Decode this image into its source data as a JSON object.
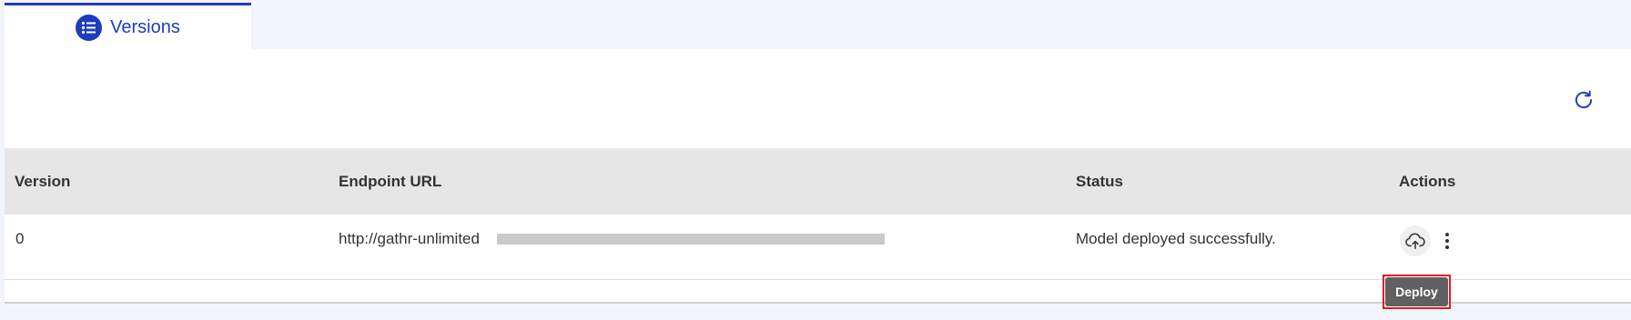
{
  "tabs": [
    {
      "label": "Versions",
      "icon": "list-icon",
      "active": true
    }
  ],
  "toolbar": {
    "refresh_icon": "refresh-icon"
  },
  "table": {
    "columns": [
      "Version",
      "Endpoint URL",
      "Status",
      "Actions"
    ],
    "rows": [
      {
        "version": "0",
        "endpoint_url": "http://gathr-unlimited",
        "status": "Model deployed successfully.",
        "actions": [
          "cloud-upload-icon",
          "more-vertical-icon"
        ]
      }
    ]
  },
  "tooltip": {
    "text": "Deploy"
  },
  "colors": {
    "accent": "#1d3dbd",
    "header_bg": "#e6e6e6",
    "page_bg": "#f3f5fc",
    "tooltip_bg": "#616161",
    "highlight": "#e01b24"
  }
}
